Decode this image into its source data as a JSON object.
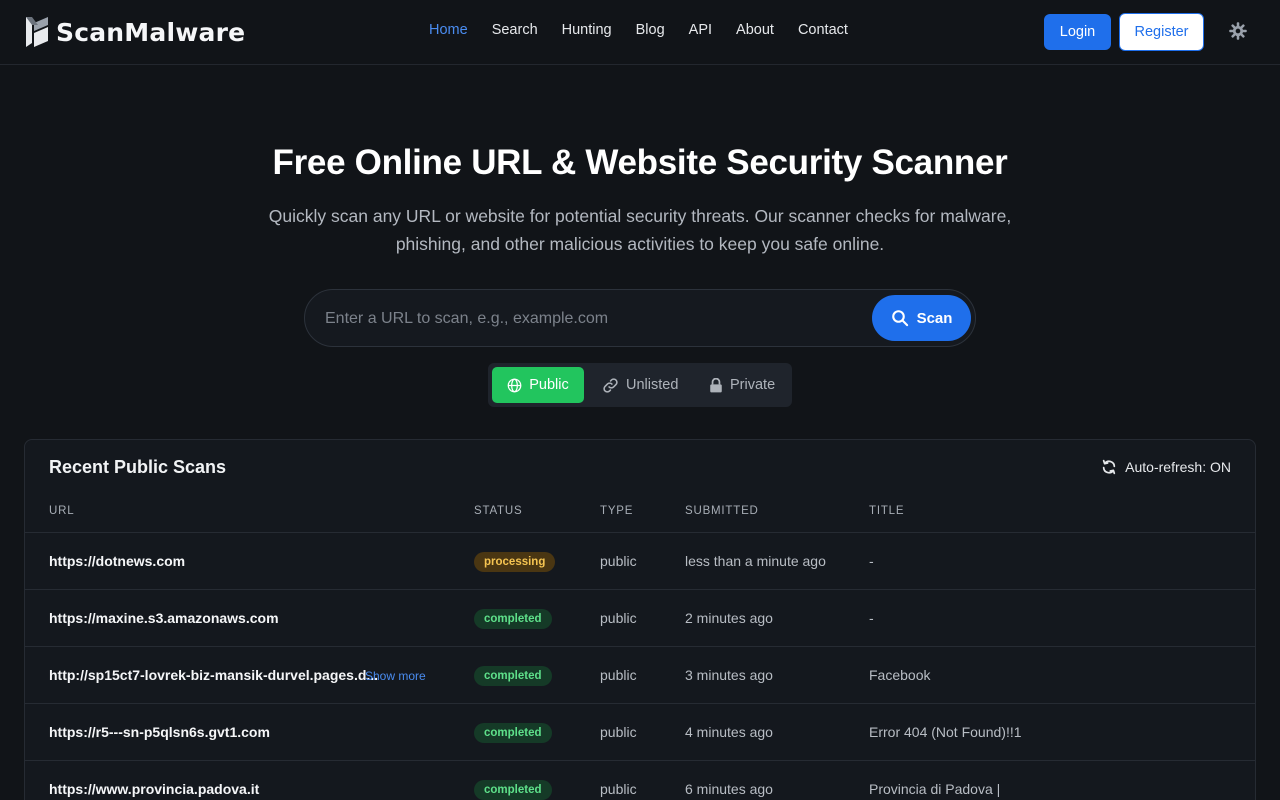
{
  "brand": {
    "name": "ScanMalware"
  },
  "nav": {
    "items": [
      {
        "label": "Home",
        "active": true
      },
      {
        "label": "Search"
      },
      {
        "label": "Hunting"
      },
      {
        "label": "Blog"
      },
      {
        "label": "API"
      },
      {
        "label": "About"
      },
      {
        "label": "Contact"
      }
    ],
    "login_label": "Login",
    "register_label": "Register",
    "theme_icon": "gear-icon"
  },
  "hero": {
    "title": "Free Online URL & Website Security Scanner",
    "subtitle": "Quickly scan any URL or website for potential security threats. Our scanner checks for malware, phishing, and other malicious activities to keep you safe online."
  },
  "search": {
    "placeholder": "Enter a URL to scan, e.g., example.com",
    "value": "",
    "button_label": "Scan"
  },
  "visibility": {
    "options": [
      {
        "label": "Public",
        "icon": "globe-icon",
        "selected": true
      },
      {
        "label": "Unlisted",
        "icon": "link-icon"
      },
      {
        "label": "Private",
        "icon": "lock-icon"
      }
    ]
  },
  "recent": {
    "title": "Recent Public Scans",
    "autorefresh_label": "Auto-refresh: ON",
    "columns": [
      "URL",
      "STATUS",
      "TYPE",
      "SUBMITTED",
      "TITLE"
    ],
    "show_more_label": "Show more",
    "rows": [
      {
        "url": "https://dotnews.com",
        "status": "processing",
        "type": "public",
        "submitted": "less than a minute ago",
        "title": "-"
      },
      {
        "url": "https://maxine.s3.amazonaws.com",
        "status": "completed",
        "type": "public",
        "submitted": "2 minutes ago",
        "title": "-"
      },
      {
        "url": "http://sp15ct7-lovrek-biz-mansik-durvel.pages.d...",
        "status": "completed",
        "type": "public",
        "submitted": "3 minutes ago",
        "title": "Facebook",
        "truncated": true
      },
      {
        "url": "https://r5---sn-p5qlsn6s.gvt1.com",
        "status": "completed",
        "type": "public",
        "submitted": "4 minutes ago",
        "title": "Error 404 (Not Found)!!1"
      },
      {
        "url": "https://www.provincia.padova.it",
        "status": "completed",
        "type": "public",
        "submitted": "6 minutes ago",
        "title": "Provincia di Padova |"
      }
    ]
  },
  "colors": {
    "background": "#111418",
    "accent": "#1f6feb",
    "public_green": "#22c55e",
    "processing": "#f5c451",
    "completed": "#5ee08a"
  }
}
